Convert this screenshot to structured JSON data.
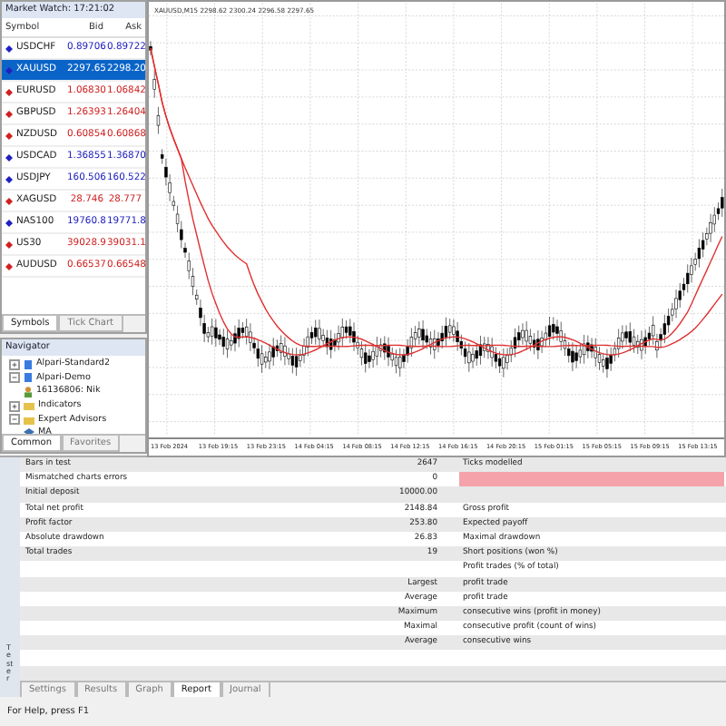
{
  "market_watch": {
    "title": "Market Watch: 17:21:02",
    "columns": [
      "Symbol",
      "Bid",
      "Ask"
    ],
    "rows": [
      {
        "symbol": "USDCHF",
        "bid": "0.89706",
        "ask": "0.89722",
        "selected": false,
        "color": "#2020c0"
      },
      {
        "symbol": "XAUUSD",
        "bid": "2297.65",
        "ask": "2298.20",
        "selected": true,
        "color": "#2020c0"
      },
      {
        "symbol": "EURUSD",
        "bid": "1.06830",
        "ask": "1.06842",
        "selected": false,
        "color": "#d02020"
      },
      {
        "symbol": "GBPUSD",
        "bid": "1.26393",
        "ask": "1.26404",
        "selected": false,
        "color": "#d02020"
      },
      {
        "symbol": "NZDUSD",
        "bid": "0.60854",
        "ask": "0.60868",
        "selected": false,
        "color": "#d02020"
      },
      {
        "symbol": "USDCAD",
        "bid": "1.36855",
        "ask": "1.36870",
        "selected": false,
        "color": "#2020c0"
      },
      {
        "symbol": "USDJPY",
        "bid": "160.506",
        "ask": "160.522",
        "selected": false,
        "color": "#2020c0"
      },
      {
        "symbol": "XAGUSD",
        "bid": "28.746",
        "ask": "28.777",
        "selected": false,
        "color": "#d02020"
      },
      {
        "symbol": "NAS100",
        "bid": "19760.8",
        "ask": "19771.8",
        "selected": false,
        "color": "#2020c0"
      },
      {
        "symbol": "US30",
        "bid": "39028.9",
        "ask": "39031.1",
        "selected": false,
        "color": "#d02020"
      },
      {
        "symbol": "AUDUSD",
        "bid": "0.66537",
        "ask": "0.66548",
        "selected": false,
        "color": "#d02020"
      }
    ],
    "tabs": [
      {
        "label": "Symbols",
        "selected": true
      },
      {
        "label": "Tick Chart",
        "selected": false
      }
    ]
  },
  "navigator": {
    "title": "Navigator",
    "tree": [
      {
        "label": "Alpari-Standard2",
        "kind": "server",
        "expanded": false
      },
      {
        "label": "Alpari-Demo",
        "kind": "server",
        "expanded": true,
        "children": [
          {
            "label": "16136806: Nik",
            "kind": "account"
          }
        ]
      },
      {
        "label": "Indicators",
        "kind": "folder",
        "expanded": false
      },
      {
        "label": "Expert Advisors",
        "kind": "folder",
        "expanded": true,
        "children": [
          {
            "label": "MA",
            "kind": "expert"
          }
        ]
      }
    ],
    "tabs": [
      {
        "label": "Common",
        "selected": true
      },
      {
        "label": "Favorites",
        "selected": false
      }
    ]
  },
  "chart": {
    "header": "XAUUSD,M15  2298.62 2300.24 2296.58 2297.65",
    "dates": [
      "13 Feb 2024",
      "13 Feb 19:15",
      "13 Feb 23:15",
      "14 Feb 04:15",
      "14 Feb 08:15",
      "14 Feb 12:15",
      "14 Feb 16:15",
      "14 Feb 20:15",
      "15 Feb 01:15",
      "15 Feb 05:15",
      "15 Feb 09:15",
      "15 Feb 13:15"
    ]
  },
  "tester": {
    "side_label": "Tester",
    "rows": [
      {
        "label": "Bars in test",
        "value": "2647",
        "label2": "Ticks modelled",
        "highlight": false
      },
      {
        "label": "Mismatched charts errors",
        "value": "0",
        "label2": "",
        "highlight": true
      },
      {
        "label": "Initial deposit",
        "value": "10000.00",
        "label2": "",
        "highlight": false
      },
      {
        "label": "Total net profit",
        "value": "2148.84",
        "label2": "Gross profit",
        "highlight": false
      },
      {
        "label": "Profit factor",
        "value": "253.80",
        "label2": "Expected payoff",
        "highlight": false
      },
      {
        "label": "Absolute drawdown",
        "value": "26.83",
        "label2": "Maximal drawdown",
        "highlight": false
      },
      {
        "label": "Total trades",
        "value": "19",
        "label2": "Short positions (won %)",
        "highlight": false
      },
      {
        "label": "",
        "value": "",
        "label2": "Profit trades (% of total)",
        "highlight": false
      },
      {
        "label": "",
        "value": "Largest",
        "label2": "profit trade",
        "highlight": false
      },
      {
        "label": "",
        "value": "Average",
        "label2": "profit trade",
        "highlight": false
      },
      {
        "label": "",
        "value": "Maximum",
        "label2": "consecutive wins (profit in money)",
        "highlight": false
      },
      {
        "label": "",
        "value": "Maximal",
        "label2": "consecutive profit (count of wins)",
        "highlight": false
      },
      {
        "label": "",
        "value": "Average",
        "label2": "consecutive wins",
        "highlight": false
      }
    ],
    "tabs": [
      {
        "label": "Settings",
        "selected": false
      },
      {
        "label": "Results",
        "selected": false
      },
      {
        "label": "Graph",
        "selected": false
      },
      {
        "label": "Report",
        "selected": true
      },
      {
        "label": "Journal",
        "selected": false
      }
    ]
  },
  "status_bar": "For Help, press F1"
}
